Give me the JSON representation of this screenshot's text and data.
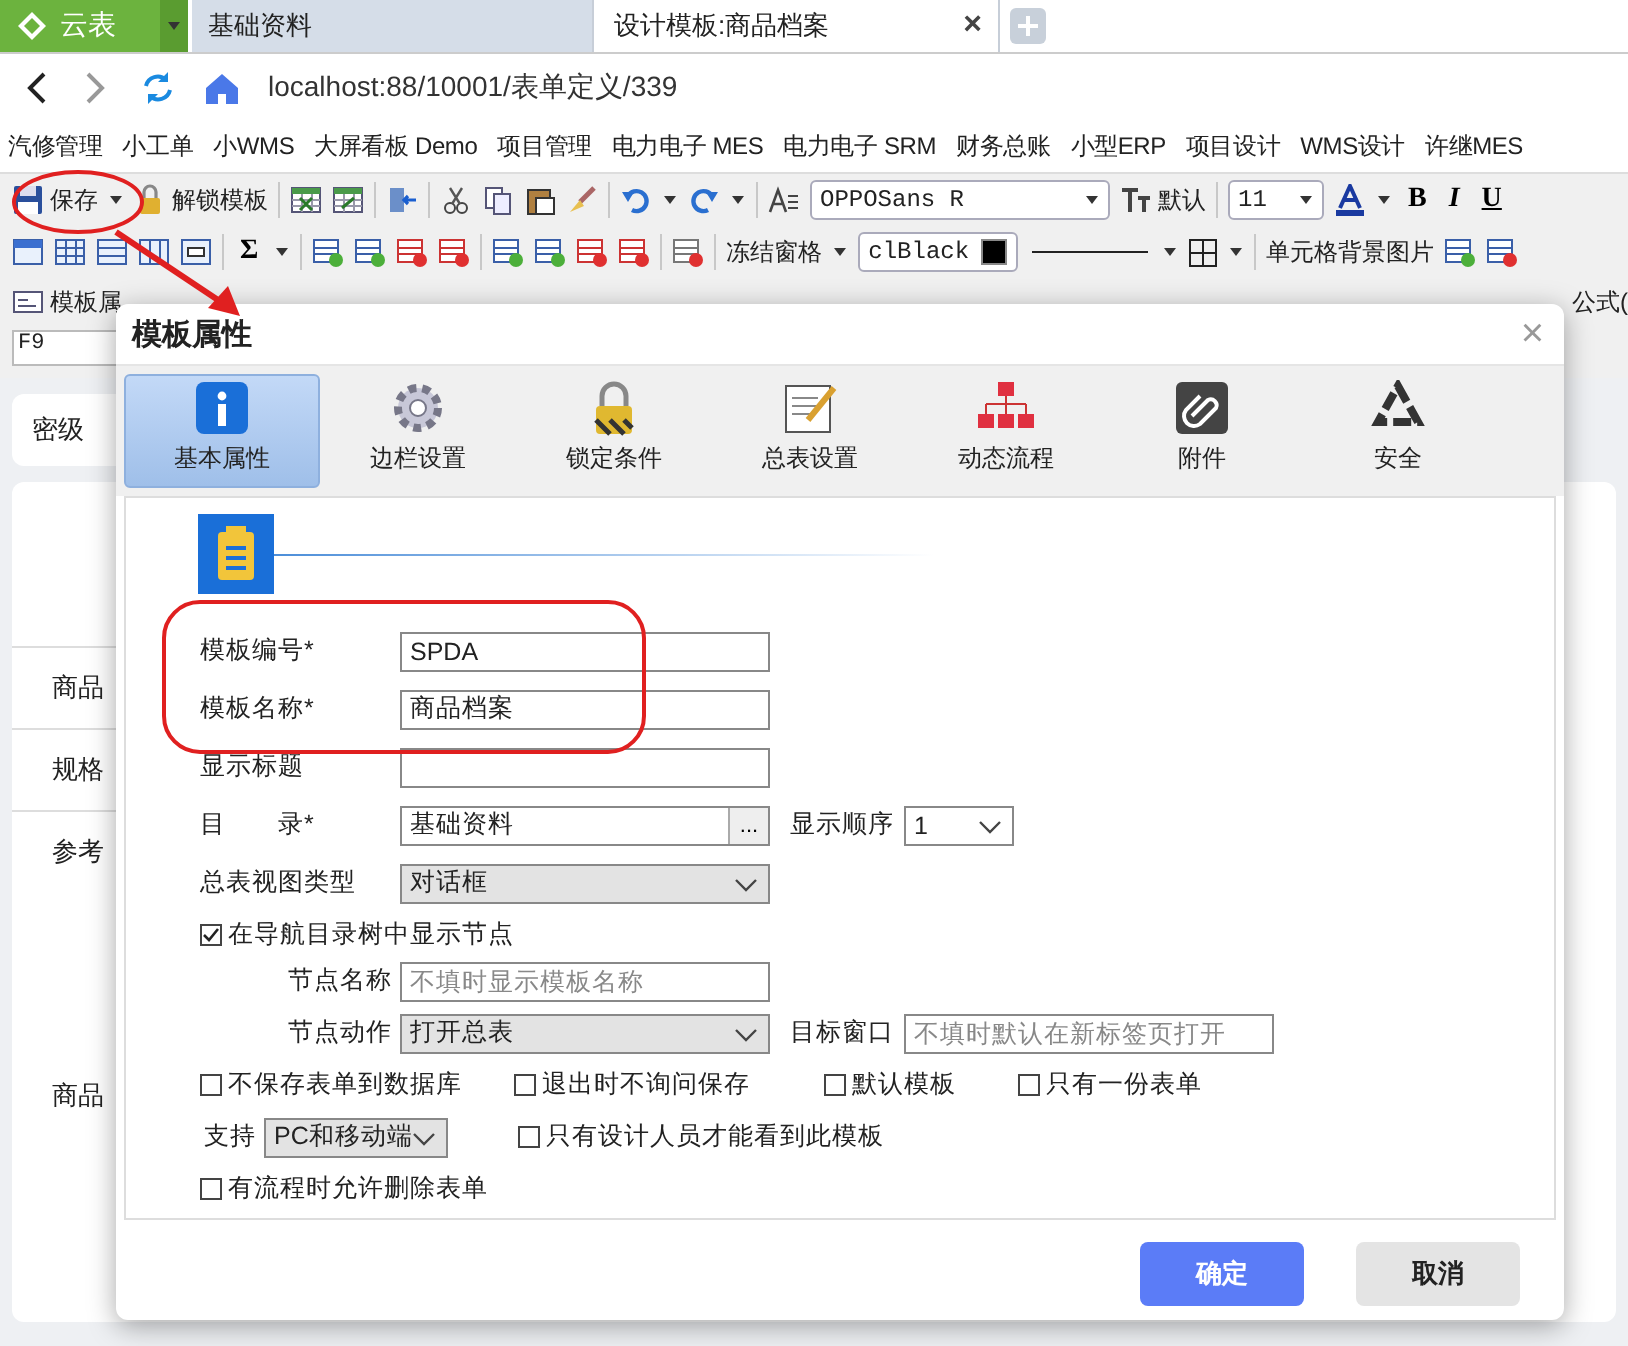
{
  "browser": {
    "logo": "云表",
    "tabs": [
      {
        "label": "基础资料",
        "selected": false
      },
      {
        "label": "设计模板:商品档案",
        "selected": true,
        "close": "×"
      }
    ],
    "url": "localhost:88/10001/表单定义/339"
  },
  "bookmarks": [
    "汽修管理",
    "小工单",
    "小WMS",
    "大屏看板 Demo",
    "项目管理",
    "电力电子 MES",
    "电力电子 SRM",
    "财务总账",
    "小型ERP",
    "项目设计",
    "WMS设计",
    "许继MES"
  ],
  "toolbar": {
    "save": "保存",
    "unlock": "解锁模板",
    "font": "OPPOSans R",
    "default_label": "默认",
    "size": "11",
    "bold": "B",
    "italic": "I",
    "underline": "U",
    "sum": "Σ",
    "freeze": "冻结窗格",
    "color_label": "clBlack",
    "cell_bg": "单元格背景图片",
    "row3_left": "模板属",
    "row3_right": "公式("
  },
  "formula_bar": {
    "cell": "F9"
  },
  "page": {
    "field": "密级",
    "labels": [
      "商品",
      "规格",
      "参考",
      "商品"
    ]
  },
  "dialog": {
    "title": "模板属性",
    "close": "×",
    "tabs": [
      {
        "label": "基本属性",
        "selected": true
      },
      {
        "label": "边栏设置",
        "selected": false
      },
      {
        "label": "锁定条件",
        "selected": false
      },
      {
        "label": "总表设置",
        "selected": false
      },
      {
        "label": "动态流程",
        "selected": false
      },
      {
        "label": "附件",
        "selected": false
      },
      {
        "label": "安全",
        "selected": false
      }
    ],
    "rows": [
      {
        "kind": "text",
        "label": "模板编号*",
        "value": "SPDA"
      },
      {
        "kind": "text",
        "label": "模板名称*",
        "value": "商品档案"
      },
      {
        "kind": "text",
        "label": "显示标题",
        "value": ""
      },
      {
        "kind": "directory",
        "label": "目　　录*",
        "value": "基础资料",
        "button": "...",
        "order_label": "显示顺序",
        "order": "1"
      },
      {
        "kind": "select",
        "label": "总表视图类型",
        "value": "对话框"
      },
      {
        "kind": "checkbox",
        "label": "在导航目录树中显示节点",
        "checked": true
      },
      {
        "kind": "sub-text",
        "label": "节点名称",
        "placeholder": "不填时显示模板名称"
      },
      {
        "kind": "sub-action",
        "label": "节点动作",
        "value": "打开总表",
        "target_label": "目标窗口",
        "target_placeholder": "不填时默认在新标签页打开"
      },
      {
        "kind": "checkbox-group",
        "items": [
          {
            "label": "不保存表单到数据库",
            "checked": false
          },
          {
            "label": "退出时不询问保存",
            "checked": false
          },
          {
            "label": "默认模板",
            "checked": false
          },
          {
            "label": "只有一份表单",
            "checked": false
          }
        ]
      },
      {
        "kind": "support",
        "label": "支持",
        "value": "PC和移动端",
        "items": [
          {
            "label": "只有设计人员才能看到此模板",
            "checked": false
          }
        ]
      },
      {
        "kind": "checkbox",
        "label": "有流程时允许删除表单",
        "checked": false
      }
    ],
    "buttons": [
      {
        "label": "确定",
        "kind": "primary"
      },
      {
        "label": "取消",
        "kind": "secondary"
      }
    ]
  }
}
